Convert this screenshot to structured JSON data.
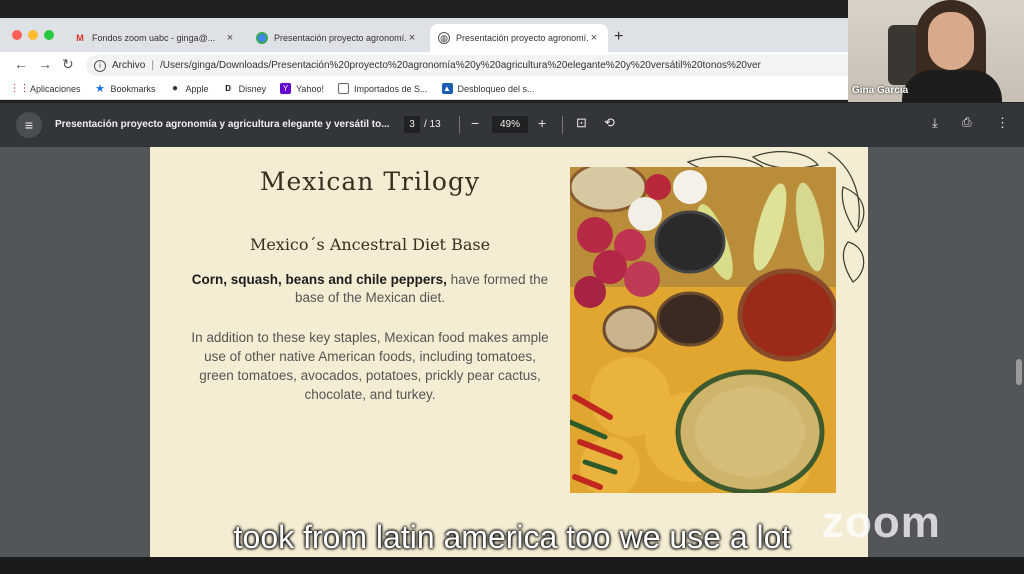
{
  "browser": {
    "tabs": [
      {
        "title": "Fondos zoom uabc - ginga@...",
        "icon": "gmail-icon",
        "active": false
      },
      {
        "title": "Presentación proyecto agronomí...",
        "icon": "chrome-icon",
        "active": false
      },
      {
        "title": "Presentación proyecto agronomí...",
        "icon": "globe-icon",
        "active": true
      }
    ],
    "address_scheme": "Archivo",
    "address_url": "/Users/ginga/Downloads/Presentación%20proyecto%20agronomía%20y%20agricultura%20elegante%20y%20versátil%20tonos%20ver",
    "bookmarks": [
      {
        "label": "Aplicaciones",
        "icon": "apps-grid-icon"
      },
      {
        "label": "Bookmarks",
        "icon": "star-icon"
      },
      {
        "label": "Apple",
        "icon": "apple-icon"
      },
      {
        "label": "Disney",
        "icon": "disney-icon"
      },
      {
        "label": "Yahoo!",
        "icon": "yahoo-icon"
      },
      {
        "label": "Importados de S...",
        "icon": "folder-icon"
      },
      {
        "label": "Desbloqueo del s...",
        "icon": "app-icon"
      }
    ]
  },
  "webcam": {
    "participant_name": "Gina García"
  },
  "pdf_viewer": {
    "document_title": "Presentación proyecto agronomía y agricultura elegante y versátil to...",
    "current_page": "3",
    "total_pages": "/ 13",
    "zoom": "49%"
  },
  "slide": {
    "title": "Mexican Trilogy",
    "subtitle": "Mexico´s Ancestral Diet Base",
    "lead_bold": "Corn, squash,  beans and chile peppers,",
    "lead_rest": " have formed the base of the Mexican diet.",
    "paragraph": "In addition to these key staples, Mexican food makes ample use of other native American foods, including tomatoes, green tomatoes, avocados, potatoes, prickly pear cactus, chocolate, and turkey."
  },
  "caption": "took from latin america too we use a lot",
  "zoom_watermark": "zoom"
}
